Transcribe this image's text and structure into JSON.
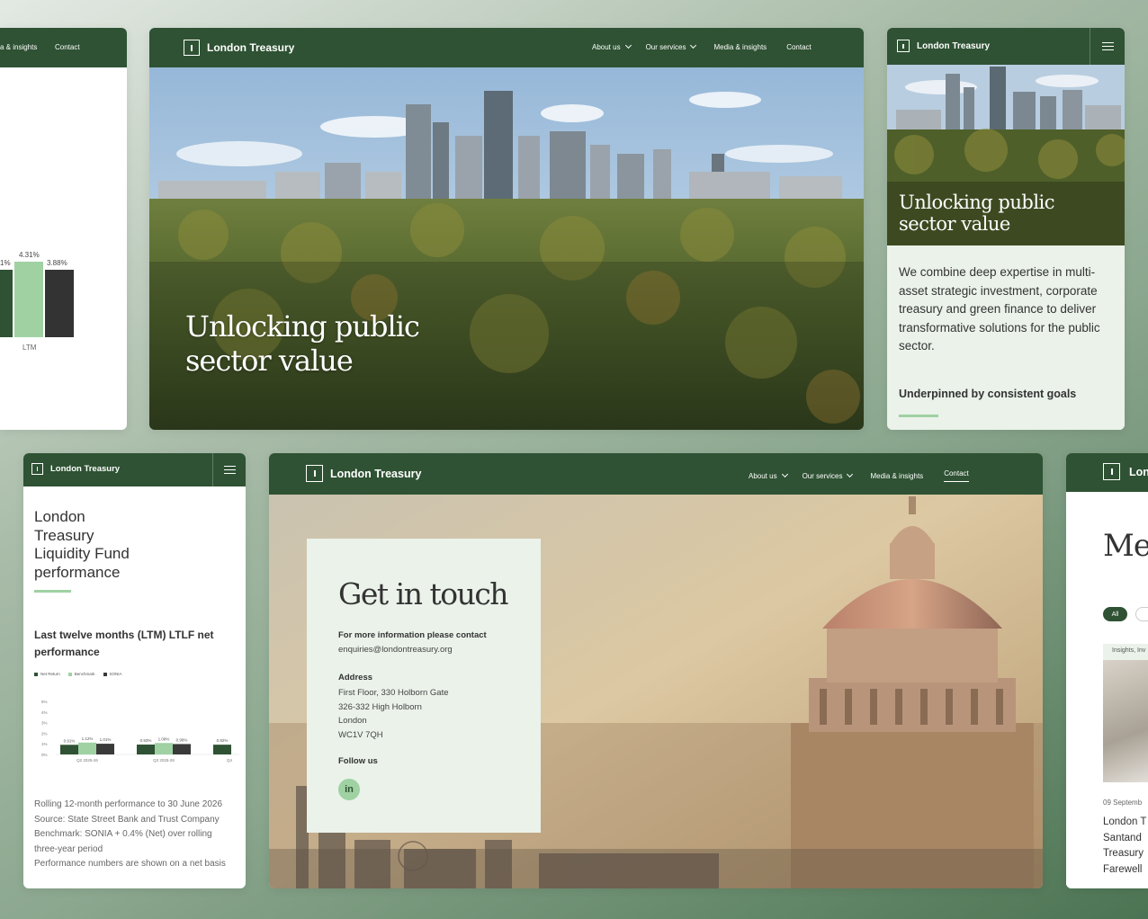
{
  "brand": "London Treasury",
  "nav": {
    "about": "About us",
    "services": "Our services",
    "media": "Media & insights",
    "media_partial": "a & insights",
    "contact": "Contact"
  },
  "hero": {
    "title_line1": "Unlocking public",
    "title_line2": "sector value"
  },
  "mobile_hero": {
    "body": "We combine deep expertise in multi-asset strategic investment, corporate treasury and green finance to deliver transformative solutions for the public sector.",
    "subheading": "Underpinned by consistent goals"
  },
  "chart_crop": {
    "labels": [
      "1%",
      "4.31%",
      "3.88%"
    ],
    "category": "LTM"
  },
  "fund": {
    "title_lines": [
      "London",
      "Treasury",
      "Liquidity Fund",
      "performance"
    ],
    "subtitle": "Last twelve months (LTM) LTLF net performance",
    "legend": [
      "Net Return",
      "Benchmark",
      "SONIA"
    ],
    "notes": [
      "Rolling 12-month performance to 30 June 2026",
      "Source: State Street Bank and Trust Company",
      "Benchmark: SONIA + 0.4% (Net) over rolling three-year period",
      "Performance numbers are shown on a net basis"
    ]
  },
  "chart_data": {
    "type": "bar",
    "categories": [
      "Q2 2025-26",
      "Q3 2025-26",
      "Q4"
    ],
    "series": [
      {
        "name": "Net Return",
        "values": [
          0.91,
          0.93,
          0.92
        ]
      },
      {
        "name": "Benchmark",
        "values": [
          1.12,
          1.08,
          null
        ]
      },
      {
        "name": "SONIA",
        "values": [
          1.01,
          0.98,
          null
        ]
      }
    ],
    "yticks": [
      "5%",
      "4%",
      "3%",
      "2%",
      "1%",
      "0%"
    ],
    "ylim": [
      0,
      5
    ],
    "value_labels": [
      [
        "0.91%",
        "1.12%",
        "1.01%"
      ],
      [
        "0.93%",
        "1.08%",
        "0.98%"
      ],
      [
        "0.92%"
      ]
    ],
    "colors": [
      "#2e5233",
      "#9fd1a3",
      "#3a3a3a"
    ]
  },
  "contact": {
    "title": "Get in touch",
    "intro_label": "For more information please contact",
    "email": "enquiries@londontreasury.org",
    "address_label": "Address",
    "address_lines": [
      "First Floor, 330 Holborn Gate",
      "326-332 High Holborn",
      "London",
      "WC1V 7QH"
    ],
    "follow_label": "Follow us",
    "linkedin": "in"
  },
  "media_crop": {
    "title": "Me",
    "filter_all": "All",
    "tag": "Insights, Inv",
    "date": "09 Septemb",
    "headline_lines": [
      "London T",
      "Santand",
      "Treasury",
      "Farewell"
    ],
    "logo_partial": "Lon"
  },
  "colors": {
    "brand_green": "#2e5233",
    "accent_green": "#9fd1a3",
    "panel_tint": "#eaf2ea"
  }
}
